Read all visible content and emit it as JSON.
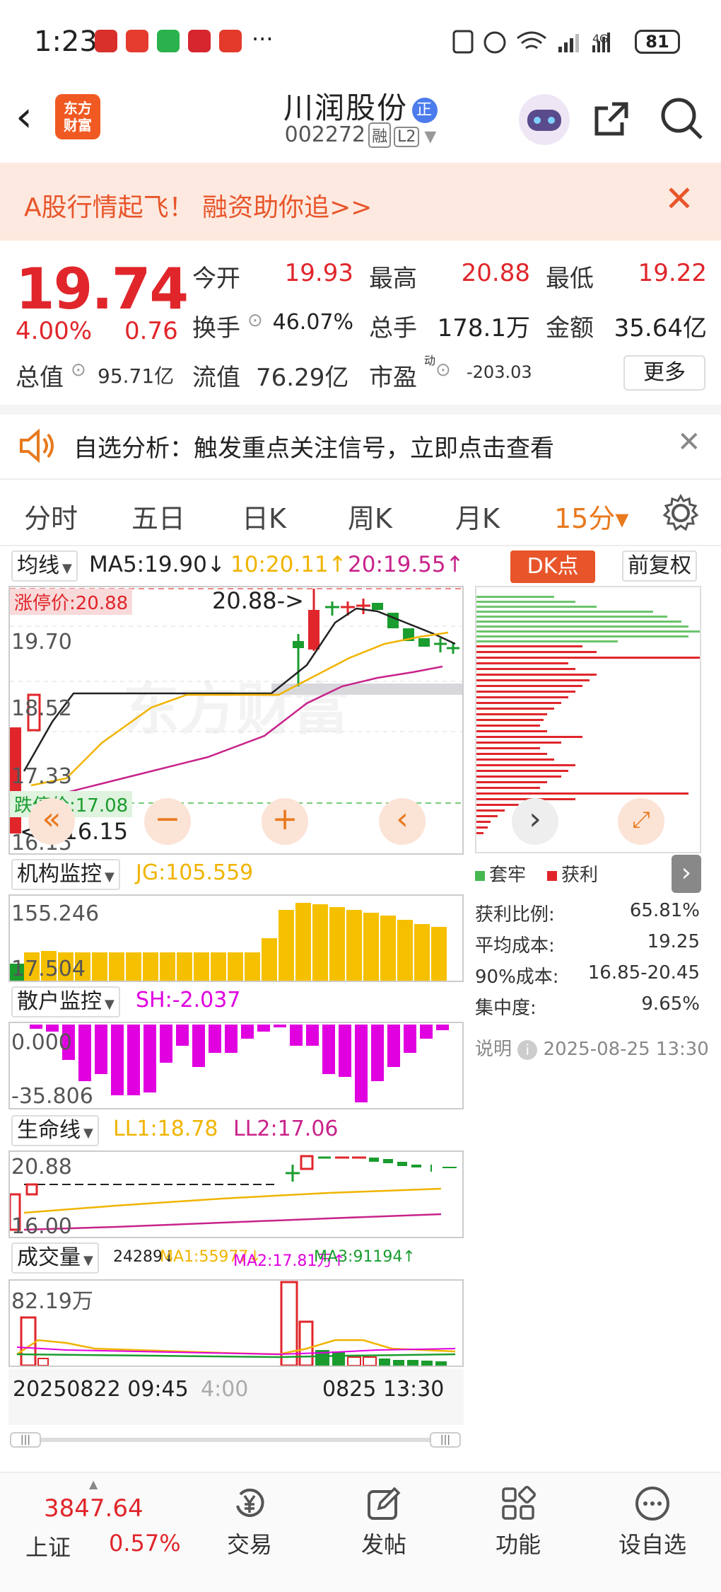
{
  "status_bar": {
    "time": "1:23",
    "dots": "···",
    "battery": "81",
    "network": "4G"
  },
  "header": {
    "back": "‹",
    "logo": "东方\n财富",
    "title": "川润股份",
    "title_badge": "正",
    "code": "002272",
    "tag1": "融",
    "tag2": "L2"
  },
  "banner": {
    "text": "A股行情起飞！ 融资助你追>>",
    "close": "✕"
  },
  "quote": {
    "price": "19.74",
    "change_pct": "4.00%",
    "change": "0.76",
    "open_label": "今开",
    "open": "19.93",
    "high_label": "最高",
    "high": "20.88",
    "low_label": "最低",
    "low": "19.22",
    "turnover_label": "换手",
    "turnover": "46.07%",
    "volume_label": "总手",
    "volume": "178.1万",
    "amount_label": "金额",
    "amount": "35.64亿",
    "mcap_label": "总值",
    "mcap": "95.71亿",
    "float_label": "流值",
    "float": "76.29亿",
    "pe_label": "市盈",
    "pe_sup": "动",
    "pe": "-203.03",
    "more": "更多"
  },
  "alert": {
    "text": "自选分析：触发重点关注信号，立即点击查看",
    "close": "✕"
  },
  "tabs": [
    "分时",
    "五日",
    "日K",
    "周K",
    "月K",
    "15分▾"
  ],
  "chart": {
    "ma_select": "均线",
    "ma5": "MA5:19.90↓",
    "ma10": "10:20.11↑",
    "ma20": "20:19.55↑",
    "dk": "DK点",
    "fq": "前复权",
    "limit_up": "涨停价:20.88",
    "limit_down": "跌停价:17.08",
    "y1": "19.70",
    "y2": "18.52",
    "y3": "17.33",
    "y4": "16.15",
    "max_note": "20.88->",
    "min_note": "<---16.15",
    "watermark": "东方财富"
  },
  "chip": {
    "legend_trap": "套牢",
    "legend_profit": "获利",
    "stats": [
      {
        "label": "获利比例:",
        "value": "65.81%"
      },
      {
        "label": "平均成本:",
        "value": "19.25"
      },
      {
        "label": "90%成本:",
        "value": "16.85-20.45"
      },
      {
        "label": "集中度:",
        "value": "9.65%"
      }
    ],
    "note": "说明",
    "date": "2025-08-25 13:30"
  },
  "jg": {
    "select": "机构监控",
    "value": "JG:105.559",
    "top": "155.246",
    "bottom": "17.504"
  },
  "sh": {
    "select": "散户监控",
    "value": "SH:-2.037",
    "top": "0.000",
    "bottom": "-35.806"
  },
  "ll": {
    "select": "生命线",
    "ll1": "LL1:18.78",
    "ll2": "LL2:17.06",
    "top": "20.88",
    "bottom": "16.00"
  },
  "vol": {
    "select": "成交量",
    "vol": "24289↓",
    "ma1": "MA1:55977↓",
    "ma2": "MA2:17.81万↑",
    "ma3": "MA3:91194↑",
    "top": "82.19万",
    "date_left": "20250822 09:45",
    "date_mid": "4:00",
    "date_right": "0825 13:30"
  },
  "nav": {
    "index_value": "3847.64",
    "index_name": "上证",
    "index_chg": "0.57%",
    "items": [
      "交易",
      "发帖",
      "功能",
      "设自选"
    ]
  },
  "colors": {
    "up": "#e0262b",
    "down": "#1a9c2e",
    "accent": "#e8791d",
    "ma5": "#222222",
    "ma10": "#f0b400",
    "ma20": "#c8238a",
    "bar": "#f5c000",
    "magenta": "#e000e0"
  }
}
